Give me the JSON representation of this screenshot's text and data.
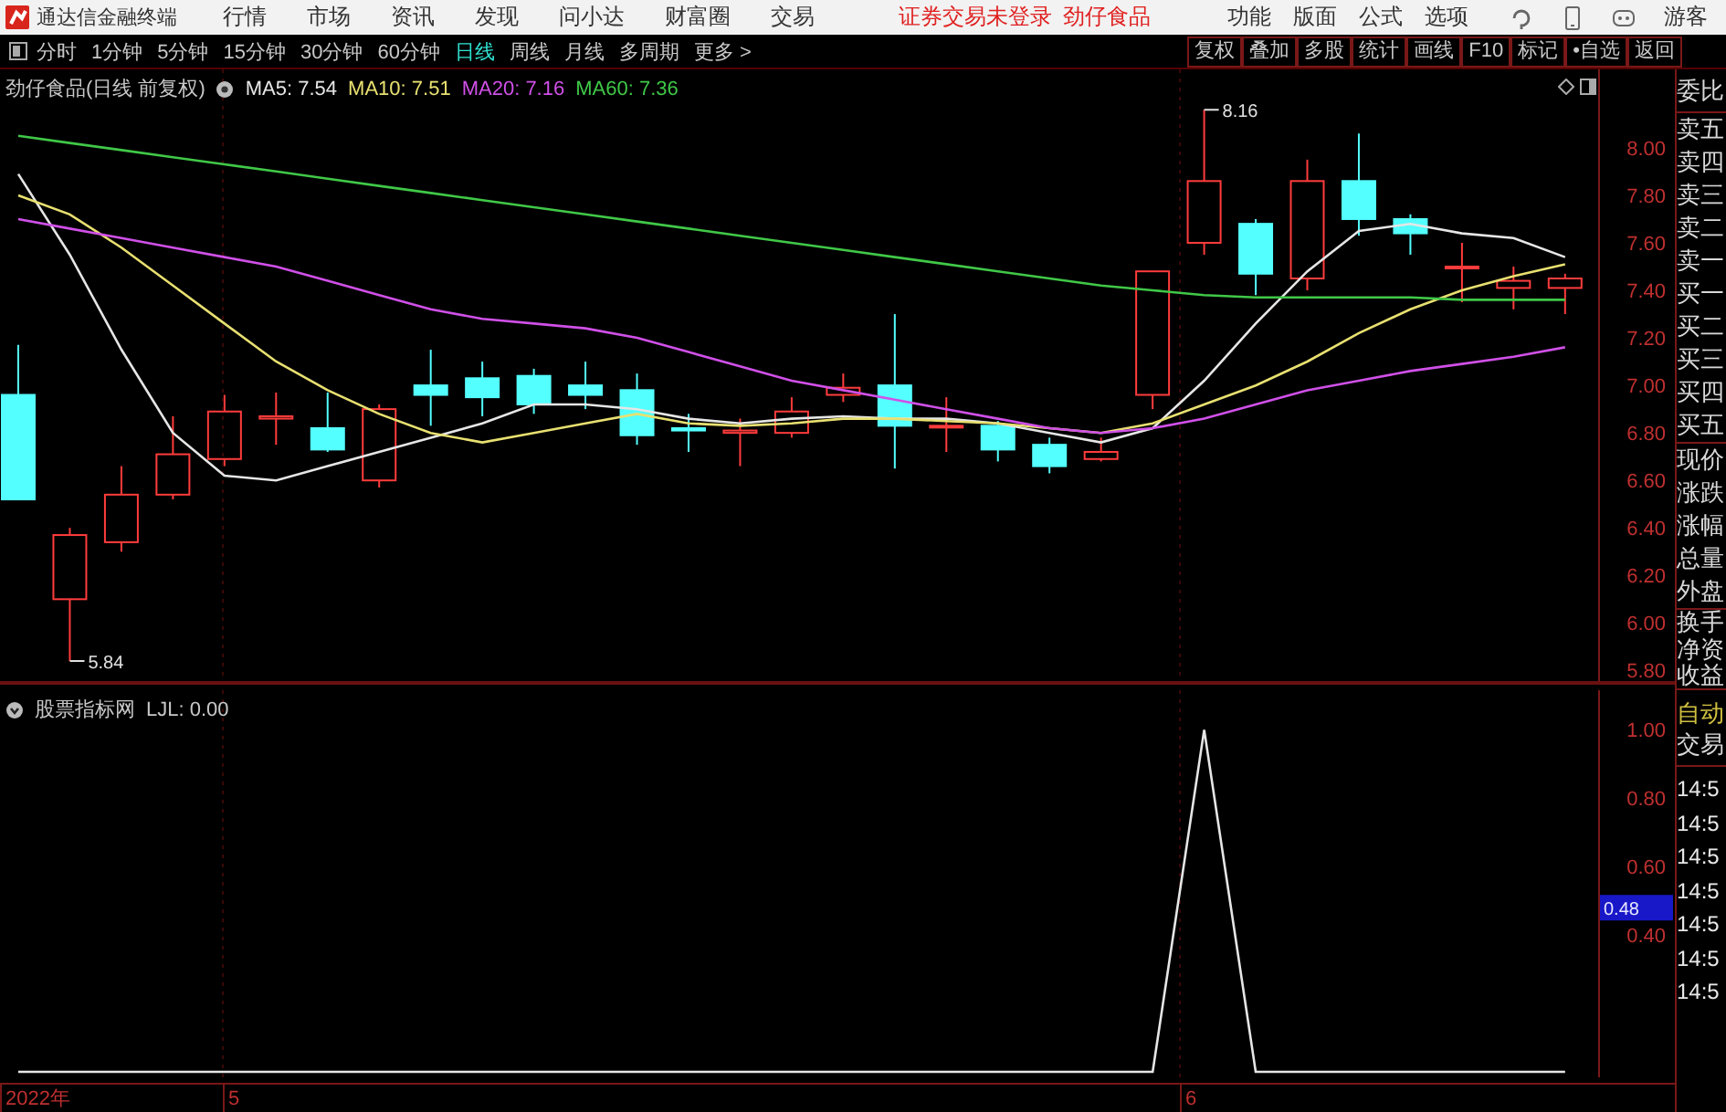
{
  "app": {
    "title": "通达信金融终端",
    "menu": [
      "行情",
      "市场",
      "资讯",
      "发现",
      "问小达",
      "财富圈",
      "交易"
    ],
    "status": [
      "证券交易未登录",
      "劲仔食品"
    ],
    "tools": [
      "功能",
      "版面",
      "公式",
      "选项"
    ],
    "user": "游客"
  },
  "toolbar": {
    "periods": [
      {
        "label": "分时",
        "selected": false
      },
      {
        "label": "1分钟",
        "selected": false
      },
      {
        "label": "5分钟",
        "selected": false
      },
      {
        "label": "15分钟",
        "selected": false
      },
      {
        "label": "30分钟",
        "selected": false
      },
      {
        "label": "60分钟",
        "selected": false
      },
      {
        "label": "日线",
        "selected": true
      },
      {
        "label": "周线",
        "selected": false
      },
      {
        "label": "月线",
        "selected": false
      },
      {
        "label": "多周期",
        "selected": false
      }
    ],
    "more": "更多 >",
    "buttons": [
      "复权",
      "叠加",
      "多股",
      "统计",
      "画线",
      "F10",
      "标记",
      "•自选",
      "返回"
    ]
  },
  "price_panel": {
    "title": "劲仔食品(日线 前复权)",
    "readouts": [
      ": 7.54",
      ": 7.51",
      ": 7.16",
      ": 7.36"
    ],
    "high_label": "8.16",
    "low_label": "5.84",
    "chart_data": {
      "type": "line",
      "ylim": [
        5.74,
        8.33
      ],
      "yticks": [
        {
          "value": 8,
          "label": "8.00"
        },
        {
          "value": 7.8,
          "label": "7.80"
        },
        {
          "value": 7.6,
          "label": "7.60"
        },
        {
          "value": 7.4,
          "label": "7.40"
        },
        {
          "value": 7.2,
          "label": "7.20"
        },
        {
          "value": 7,
          "label": "7.00"
        },
        {
          "value": 6.8,
          "label": "6.80"
        },
        {
          "value": 6.6,
          "label": "6.60"
        },
        {
          "value": 6.4,
          "label": "6.40"
        },
        {
          "value": 6.2,
          "label": "6.20"
        },
        {
          "value": 6,
          "label": "6.00"
        },
        {
          "value": 5.8,
          "label": "5.80"
        }
      ],
      "series": [
        {
          "name": "MA5",
          "color": "#e6e6e6",
          "values": [
            7.89,
            7.55,
            7.15,
            6.8,
            6.62,
            6.6,
            6.66,
            6.72,
            6.78,
            6.84,
            6.92,
            6.92,
            6.9,
            6.86,
            6.84,
            6.86,
            6.87,
            6.86,
            6.86,
            6.84,
            6.8,
            6.76,
            6.82,
            7.02,
            7.26,
            7.48,
            7.65,
            7.68,
            7.64,
            7.62,
            7.54
          ]
        },
        {
          "name": "MA10",
          "color": "#e8e070",
          "values": [
            7.8,
            7.72,
            7.58,
            7.42,
            7.26,
            7.1,
            6.98,
            6.88,
            6.8,
            6.76,
            6.8,
            6.84,
            6.88,
            6.84,
            6.83,
            6.84,
            6.86,
            6.86,
            6.85,
            6.84,
            6.82,
            6.8,
            6.84,
            6.92,
            7.0,
            7.1,
            7.22,
            7.32,
            7.4,
            7.46,
            7.51
          ]
        },
        {
          "name": "MA20",
          "color": "#d050e8",
          "values": [
            7.7,
            7.66,
            7.62,
            7.58,
            7.54,
            7.5,
            7.44,
            7.38,
            7.32,
            7.28,
            7.26,
            7.24,
            7.2,
            7.14,
            7.08,
            7.02,
            6.98,
            6.94,
            6.9,
            6.86,
            6.82,
            6.8,
            6.82,
            6.86,
            6.92,
            6.98,
            7.02,
            7.06,
            7.09,
            7.12,
            7.16
          ]
        },
        {
          "name": "MA60",
          "color": "#40c848",
          "values": [
            8.05,
            8.02,
            7.99,
            7.96,
            7.93,
            7.9,
            7.87,
            7.84,
            7.81,
            7.78,
            7.75,
            7.72,
            7.69,
            7.66,
            7.63,
            7.6,
            7.57,
            7.54,
            7.51,
            7.48,
            7.45,
            7.42,
            7.4,
            7.38,
            7.37,
            7.37,
            7.37,
            7.37,
            7.36,
            7.36,
            7.36
          ]
        }
      ]
    }
  },
  "indicator_panel": {
    "name": "股票指标网",
    "readout": ": 0.00",
    "cursor_value": "0.48",
    "chart_data": {
      "type": "line",
      "ylim": [
        0,
        1.1
      ],
      "yticks": [
        {
          "value": 1,
          "label": "1.00"
        },
        {
          "value": 0.8,
          "label": "0.80"
        },
        {
          "value": 0.6,
          "label": "0.60"
        },
        {
          "value": 0.4,
          "label": "0.40"
        }
      ],
      "series": [
        {
          "name": "LJL",
          "color": "#e6e6e6",
          "values": [
            0,
            0,
            0,
            0,
            0,
            0,
            0,
            0,
            0,
            0,
            0,
            0,
            0,
            0,
            0,
            0,
            0,
            0,
            0,
            0,
            0,
            0,
            0,
            1,
            0,
            0,
            0,
            0,
            0,
            0,
            0
          ]
        }
      ]
    }
  },
  "time_axis": [
    "2022年",
    "5",
    "6"
  ],
  "quote_panel": {
    "groups": [
      [
        "委比"
      ],
      [
        "卖五",
        "卖四",
        "卖三",
        "卖二",
        "卖一",
        "买一",
        "买二",
        "买三",
        "买四",
        "买五"
      ],
      [
        "现价",
        "涨跌",
        "涨幅",
        "总量",
        "外盘"
      ],
      [
        "换手",
        "净资",
        "收益"
      ]
    ],
    "mode": "自动",
    "trade_title": "交易",
    "times": [
      "14:5",
      "14:5",
      "14:5",
      "14:5",
      "14:5",
      "14:5",
      "14:5"
    ]
  }
}
